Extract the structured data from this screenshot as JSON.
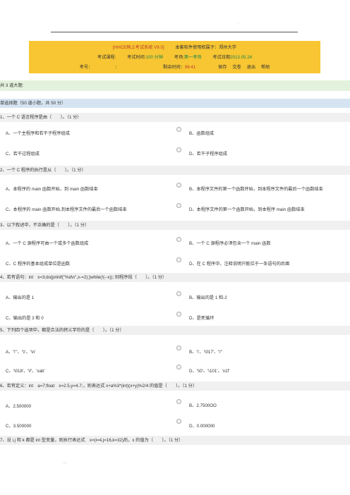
{
  "top_dot": ".",
  "banner": {
    "system": "[HHCE网上考试系统 V9.0]",
    "license": "本套软件使用权属于：郑州大学",
    "course_label": "考试课程:",
    "time_label": "考试时间:",
    "time_value": "100 分钟",
    "room_label": "考场:",
    "room_value": "第一考场",
    "date_label": "考试日期",
    "date_value": "2013.05.24",
    "id_label": "考号：",
    "name_label": "：",
    "remain_label": "剩余时间：",
    "remain_value": "99:41",
    "save": "保存",
    "submit": "交卷",
    "exit": "退出",
    "help": "帮助"
  },
  "section_title": "共 3 道大题:",
  "part_title": "单选择题（50 道小题，共 50 分）",
  "questions": [
    {
      "text": "1、一个 C 语言程序是由（　　）。（1 分）",
      "options": [
        "A、一个主程序和若干子程序组成",
        "B、函数组成",
        "C、若干过程组成",
        "D、若干子程序组成"
      ]
    },
    {
      "text": "2、一个 C 程序的执行是从（　　）。（1 分）",
      "options": [
        "A、本程序的 main 函数开始，到 main 函数结束",
        "B、本程序文件的第一个函数开始，到本程序文件的最后一个函数结束",
        "C、本程序的 main 函数开始,到本程序文件的最后一个函数结束",
        "D、本程序文件的第一个函数开始，到本程序 main 函数结束"
      ]
    },
    {
      "text": "3、以下叙述中，不正确的是（　　）。（1 分）",
      "options": [
        "A、一个 C 源程序可由一个或多个函数组成",
        "B、一个 C 源程序必须包含一个 main 函数",
        "C、C 程序的基本组成单位是函数",
        "D、在 C 程序中，注释说明只能位于一条语句的后面"
      ]
    },
    {
      "text": "4、若有语句：int　x=3;do{printf(\"%d\\n\",x-=2);}while(!(--x)); 则程序段（　　）。（1 分）",
      "options": [
        "A、输出的是 1",
        "B、输出的是 1 和-2",
        "C、输出的是 3 和 0",
        "D、是死循环"
      ]
    },
    {
      "text": "5、下列四个选项中，都是合法的转义字符的是（　　）。（1 分）",
      "options": [
        "A、'\\\"'、'\\\\'、'\\n'",
        "B、'\\'、'\\017'、'\\\"'",
        "C、'\\018'、'\\f'、'xab'",
        "D、'\\\\0'、'\\101'、'x1f'"
      ]
    },
    {
      "text": "6、若有定义：int　a=7;float　x=2.5,y=4.7;，则表达式 x+a%3*(int)(x+y)%2/4 的值是（　　）。（1 分）",
      "options": [
        "A、2.500000",
        "B、2.7500OO",
        "C、3.500000",
        "D、0.000000"
      ]
    },
    {
      "text": "7、设 i,j 和 k 都是 int 型变量，则执行表达式　x=(i=4,j=16,k=32)后，x 的值为（　　）。（1 分）",
      "options": []
    }
  ],
  "footer_mark": "..."
}
